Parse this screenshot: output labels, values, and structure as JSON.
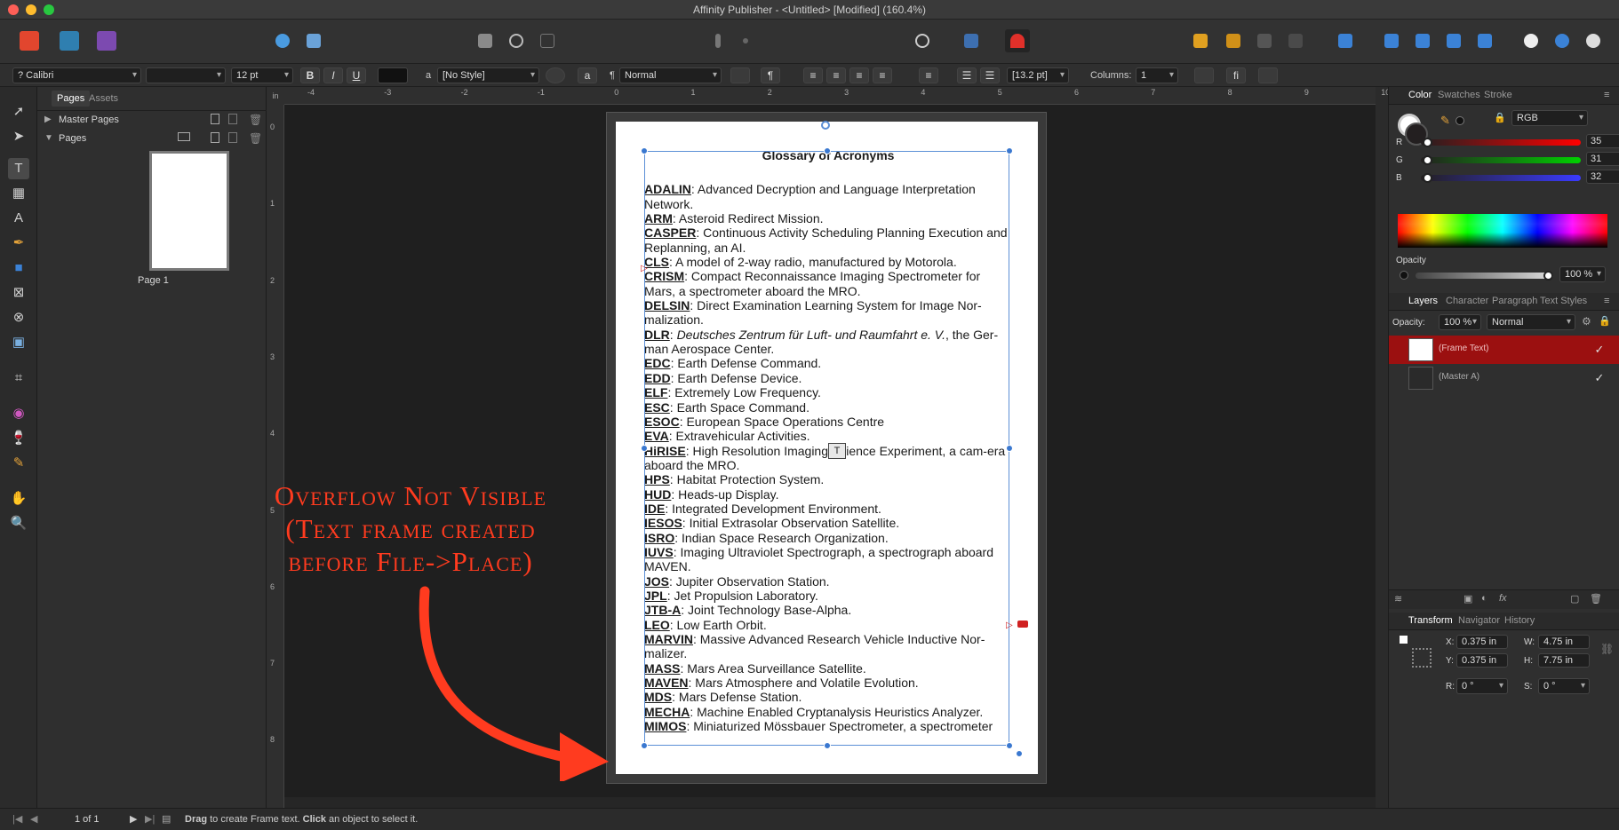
{
  "window": {
    "title": "Affinity Publisher - <Untitled> [Modified] (160.4%)"
  },
  "context_toolbar": {
    "font": "? Calibri",
    "font_style": "",
    "font_size": "12 pt",
    "bold": "B",
    "italic": "I",
    "underline": "U",
    "char_style_icon": "a",
    "char_style": "[No Style]",
    "para_style_icon": "¶",
    "para_style": "Normal",
    "leading": "[13.2 pt]",
    "columns_label": "Columns:",
    "columns_value": "1"
  },
  "pages_panel": {
    "tabs": [
      "Pages",
      "Assets"
    ],
    "master_pages_label": "Master Pages",
    "pages_label": "Pages",
    "page_thumbnail_label": "Page 1"
  },
  "ruler": {
    "top_unit": "in",
    "top_ticks": [
      "-4",
      "-3",
      "-2",
      "-1",
      "0",
      "1",
      "2",
      "3",
      "4",
      "5",
      "6",
      "7",
      "8",
      "9",
      "10"
    ],
    "left_ticks": [
      "0",
      "1",
      "2",
      "3",
      "4",
      "5",
      "6",
      "7",
      "8"
    ]
  },
  "document": {
    "title": "Glossary of Acronyms",
    "entries": [
      {
        "term": "ADALIN",
        "def": ": Advanced Decryption and Language Interpretation Network."
      },
      {
        "term": "ARM",
        "def": ": Asteroid Redirect Mission."
      },
      {
        "term": "CASPER",
        "def": ": Continuous Activity Scheduling Planning Execution and Replanning, an AI."
      },
      {
        "term": "CLS",
        "def": ": A model of 2-way radio, manufactured by Motorola."
      },
      {
        "term": "CRISM",
        "def": ": Compact Reconnaissance Imaging Spectrometer for Mars, a spectrometer aboard the MRO."
      },
      {
        "term": "DELSIN",
        "def": ": Direct Examination Learning System for Image Nor-malization."
      },
      {
        "term": "DLR",
        "def": ": Deutsches Zentrum für Luft- und Raumfahrt e. V., the Ger-man Aerospace Center."
      },
      {
        "term": "EDC",
        "def": ": Earth Defense Command."
      },
      {
        "term": "EDD",
        "def": ": Earth Defense Device."
      },
      {
        "term": "ELF",
        "def": ": Extremely Low Frequency."
      },
      {
        "term": "ESC",
        "def": ": Earth Space Command."
      },
      {
        "term": "ESOC",
        "def": ": European Space Operations Centre"
      },
      {
        "term": "EVA",
        "def": ": Extravehicular Activities."
      },
      {
        "term": "HiRISE",
        "def": ": High Resolution Imaging Science Experiment, a cam-era aboard the MRO."
      },
      {
        "term": "HPS",
        "def": ": Habitat Protection System."
      },
      {
        "term": "HUD",
        "def": ": Heads-up Display."
      },
      {
        "term": "IDE",
        "def": ": Integrated Development Environment."
      },
      {
        "term": "IESOS",
        "def": ": Initial Extrasolar Observation Satellite."
      },
      {
        "term": "ISRO",
        "def": ": Indian Space Research Organization."
      },
      {
        "term": "IUVS",
        "def": ": Imaging Ultraviolet Spectrograph, a spectrograph aboard MAVEN."
      },
      {
        "term": "JOS",
        "def": ": Jupiter Observation Station."
      },
      {
        "term": "JPL",
        "def": ": Jet Propulsion Laboratory."
      },
      {
        "term": "JTB-A",
        "def": ": Joint Technology Base-Alpha."
      },
      {
        "term": "LEO",
        "def": ": Low Earth Orbit."
      },
      {
        "term": "MARVIN",
        "def": ": Massive Advanced Research Vehicle Inductive Nor-malizer."
      },
      {
        "term": "MASS",
        "def": ": Mars Area Surveillance Satellite."
      },
      {
        "term": "MAVEN",
        "def": ": Mars Atmosphere and Volatile Evolution."
      },
      {
        "term": "MDS",
        "def": ": Mars Defense Station."
      },
      {
        "term": "MECHA",
        "def": ": Machine Enabled Cryptanalysis Heuristics Analyzer."
      },
      {
        "term": "MIMOS",
        "def": ": Miniaturized Mössbauer Spectrometer, a spectrometer"
      }
    ]
  },
  "annotation": {
    "line1": "Overflow Not Visible",
    "line2": "(Text frame created",
    "line3": "before File->Place)"
  },
  "color_panel": {
    "tabs": [
      "Color",
      "Swatches",
      "Stroke"
    ],
    "model": "RGB",
    "r_label": "R",
    "r_value": "35",
    "g_label": "G",
    "g_value": "31",
    "b_label": "B",
    "b_value": "32",
    "opacity_label": "Opacity",
    "opacity_value": "100 %"
  },
  "layers_panel": {
    "tabs": [
      "Layers",
      "Character",
      "Paragraph",
      "Text Styles"
    ],
    "opacity_label": "Opacity:",
    "opacity_value": "100 %",
    "blend_mode": "Normal",
    "layers": [
      {
        "name": "(Frame Text)",
        "selected": true
      },
      {
        "name": "(Master A)",
        "selected": false
      }
    ]
  },
  "transform_panel": {
    "tabs": [
      "Transform",
      "Navigator",
      "History"
    ],
    "x_label": "X:",
    "x_value": "0.375 in",
    "y_label": "Y:",
    "y_value": "0.375 in",
    "w_label": "W:",
    "w_value": "4.75 in",
    "h_label": "H:",
    "h_value": "7.75 in",
    "r_label": "R:",
    "r_value": "0 °",
    "s_label": "S:",
    "s_value": "0 °"
  },
  "status_bar": {
    "page_counter": "1 of 1",
    "hint_bold1": "Drag",
    "hint_text1": " to create Frame text. ",
    "hint_bold2": "Click",
    "hint_text2": " an object to select it."
  },
  "colors": {
    "accent_red": "#ff3b1f",
    "selection_blue": "#3a78d0",
    "layer_selected": "#9b1010"
  }
}
